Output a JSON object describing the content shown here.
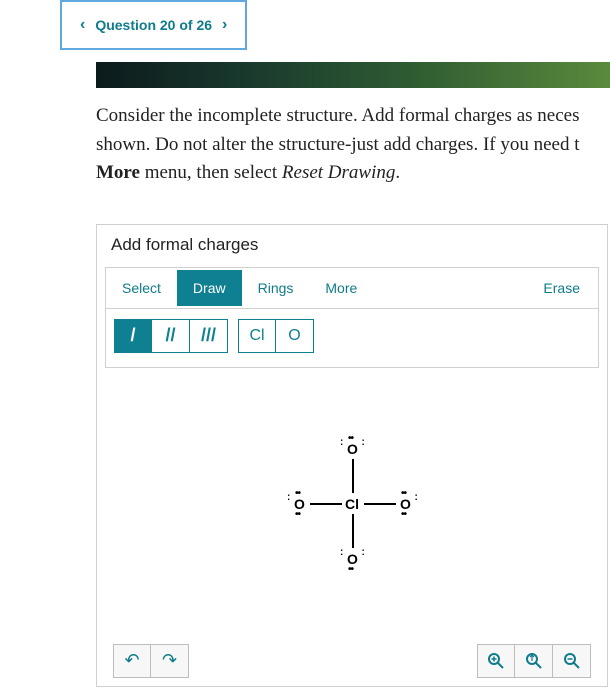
{
  "nav": {
    "label": "Question 20 of 26"
  },
  "question": {
    "part1": "Consider the incomplete structure. Add formal charges as neces",
    "part2": "shown. Do not alter the structure-just add charges. If you need t",
    "more": "More",
    "part3": " menu, then select ",
    "reset": "Reset Drawing",
    "part4": "."
  },
  "editor": {
    "title": "Add formal charges",
    "tabs": {
      "select": "Select",
      "draw": "Draw",
      "rings": "Rings",
      "more": "More",
      "erase": "Erase"
    },
    "atoms": {
      "cl": "Cl",
      "o": "O"
    },
    "molecule": {
      "center": "Cl",
      "top": "O",
      "bottom": "O",
      "left": "O",
      "right": "O"
    }
  }
}
